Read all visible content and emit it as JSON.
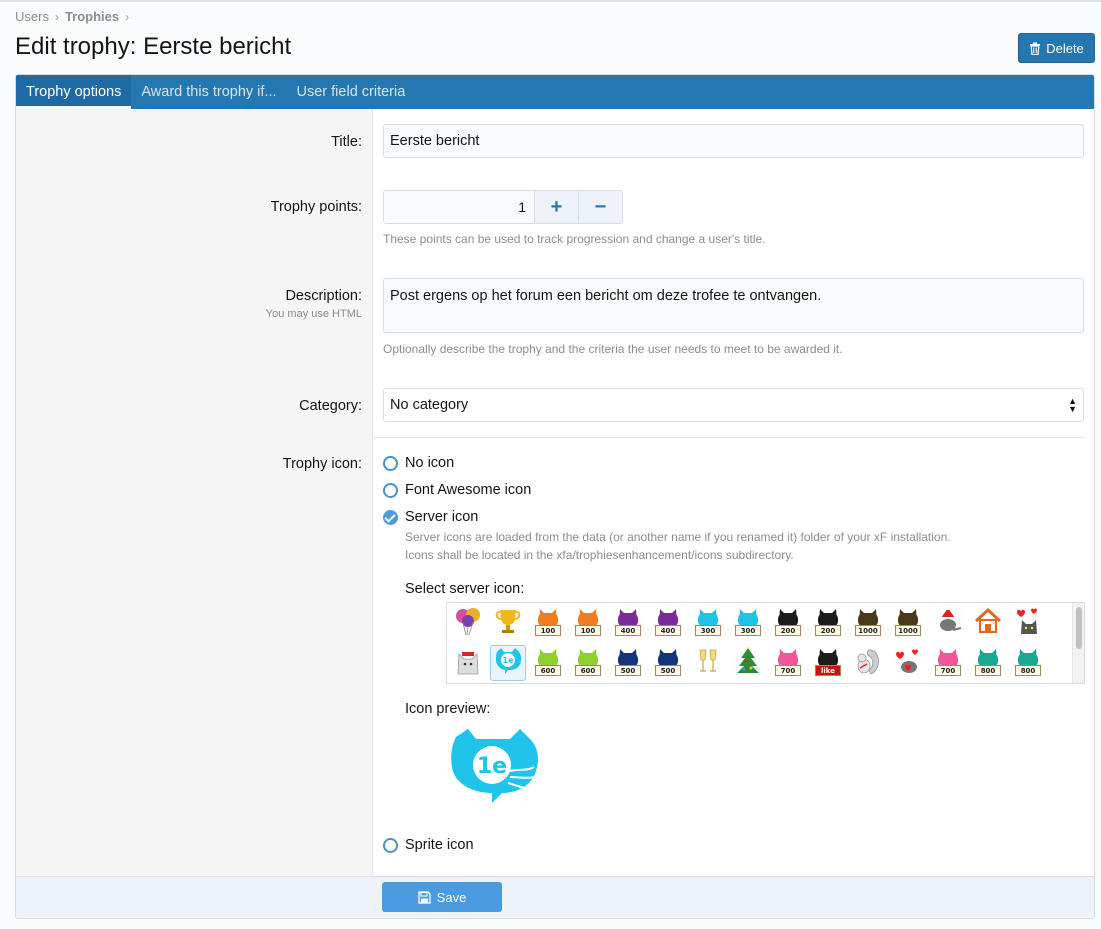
{
  "breadcrumb": {
    "item1": "Users",
    "item2": "Trophies"
  },
  "page": {
    "title": "Edit trophy: Eerste bericht",
    "delete_label": "Delete"
  },
  "tabs": [
    {
      "label": "Trophy options"
    },
    {
      "label": "Award this trophy if..."
    },
    {
      "label": "User field criteria"
    }
  ],
  "form": {
    "title_label": "Title:",
    "title_value": "Eerste bericht",
    "points_label": "Trophy points:",
    "points_value": "1",
    "points_hint": "These points can be used to track progression and change a user's title.",
    "description_label": "Description:",
    "description_sublabel": "You may use HTML",
    "description_value": "Post ergens op het forum een bericht om deze trofee te ontvangen.",
    "description_hint": "Optionally describe the trophy and the criteria the user needs to meet to be awarded it.",
    "category_label": "Category:",
    "category_value": "No category",
    "icon_label": "Trophy icon:",
    "icon_options": {
      "none": "No icon",
      "fa": "Font Awesome icon",
      "server": "Server icon",
      "sprite": "Sprite icon"
    },
    "server_explain_1": "Server icons are loaded from the data (or another name if you renamed it) folder of your xF installation.",
    "server_explain_2": "Icons shall be located in the xfa/trophiesenhancement/icons subdirectory.",
    "select_server_icon_label": "Select server icon:",
    "icon_preview_label": "Icon preview:",
    "preview_text": "1e",
    "save_label": "Save"
  },
  "icon_grid": {
    "row1": [
      {
        "kind": "balloons"
      },
      {
        "kind": "cup"
      },
      {
        "kind": "cat",
        "color": "#f07d1e",
        "sign": "100"
      },
      {
        "kind": "cat",
        "color": "#f07d1e",
        "sign": "100"
      },
      {
        "kind": "cat",
        "color": "#7a2a9a",
        "sign": "400"
      },
      {
        "kind": "cat",
        "color": "#7a2a9a",
        "sign": "400"
      },
      {
        "kind": "cat",
        "color": "#1ec4ea",
        "sign": "300"
      },
      {
        "kind": "cat",
        "color": "#1ec4ea",
        "sign": "300"
      },
      {
        "kind": "cat",
        "color": "#1c1c1c",
        "sign": "200"
      },
      {
        "kind": "cat",
        "color": "#1c1c1c",
        "sign": "200"
      },
      {
        "kind": "cat",
        "color": "#4b3a1a",
        "sign": "1000"
      },
      {
        "kind": "cat",
        "color": "#4b3a1a",
        "sign": "1000"
      },
      {
        "kind": "santa"
      },
      {
        "kind": "house"
      },
      {
        "kind": "hearts-cat"
      }
    ],
    "row2": [
      {
        "kind": "white-cat"
      },
      {
        "kind": "bubble",
        "text": "1e"
      },
      {
        "kind": "cat",
        "color": "#8fd12e",
        "sign": "600"
      },
      {
        "kind": "cat",
        "color": "#8fd12e",
        "sign": "600"
      },
      {
        "kind": "cat",
        "color": "#13367a",
        "sign": "500"
      },
      {
        "kind": "cat",
        "color": "#13367a",
        "sign": "500"
      },
      {
        "kind": "glasses"
      },
      {
        "kind": "tree"
      },
      {
        "kind": "cat",
        "color": "#f2559a",
        "sign": "700"
      },
      {
        "kind": "cat",
        "color": "#1c1c1c",
        "sign": "like"
      },
      {
        "kind": "squirrel"
      },
      {
        "kind": "love"
      },
      {
        "kind": "cat",
        "color": "#f2559a",
        "sign": "700"
      },
      {
        "kind": "cat",
        "color": "#1aa890",
        "sign": "800"
      },
      {
        "kind": "cat",
        "color": "#1aa890",
        "sign": "800"
      }
    ]
  },
  "colors": {
    "accent": "#2577b1",
    "save": "#4a9be0",
    "preview": "#1ec4ea"
  }
}
